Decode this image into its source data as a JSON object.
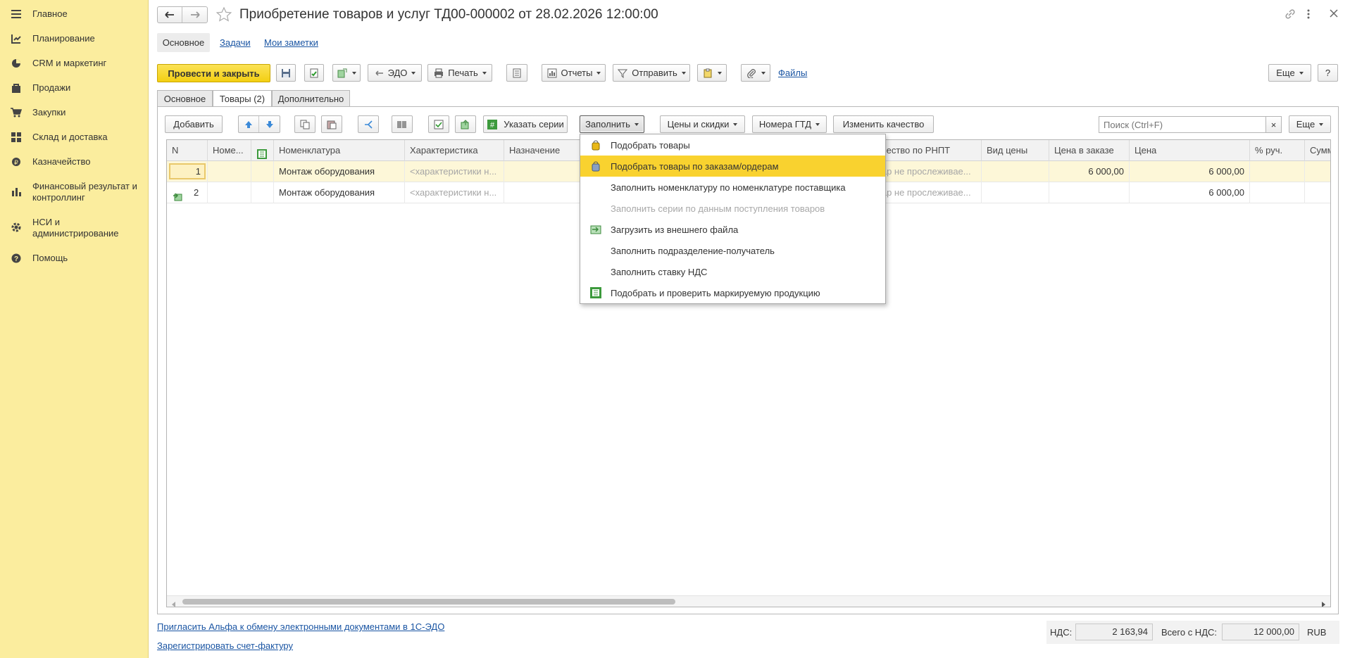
{
  "sidebar": {
    "items": [
      {
        "label": "Главное",
        "icon": "menu-icon"
      },
      {
        "label": "Планирование",
        "icon": "planning-icon"
      },
      {
        "label": "CRM и маркетинг",
        "icon": "crm-icon"
      },
      {
        "label": "Продажи",
        "icon": "sales-icon"
      },
      {
        "label": "Закупки",
        "icon": "cart-icon"
      },
      {
        "label": "Склад и доставка",
        "icon": "warehouse-icon"
      },
      {
        "label": "Казначейство",
        "icon": "treasury-icon"
      },
      {
        "label": "Финансовый результат и контроллинг",
        "icon": "finance-icon"
      },
      {
        "label": "НСИ и администрирование",
        "icon": "gear-icon"
      },
      {
        "label": "Помощь",
        "icon": "help-icon"
      }
    ]
  },
  "header": {
    "title": "Приобретение товаров и услуг ТД00-000002 от 28.02.2026 12:00:00"
  },
  "nav": {
    "main": "Основное",
    "tasks": "Задачи",
    "notes": "Мои заметки"
  },
  "toolbar": {
    "post_close": "Провести и закрыть",
    "edo": "ЭДО",
    "print": "Печать",
    "reports": "Отчеты",
    "send": "Отправить",
    "files": "Файлы",
    "more": "Еще",
    "help": "?"
  },
  "tabs": {
    "main": "Основное",
    "goods": "Товары (2)",
    "extra": "Дополнительно"
  },
  "goods_toolbar": {
    "add": "Добавить",
    "series": "Указать серии",
    "fill": "Заполнить",
    "prices": "Цены и скидки",
    "gtd": "Номера ГТД",
    "quality": "Изменить качество",
    "search_placeholder": "Поиск (Ctrl+F)",
    "clear": "×",
    "more": "Еще"
  },
  "table": {
    "headers": {
      "n": "N",
      "nome": "Номе...",
      "nomenclature": "Номенклатура",
      "characteristic": "Характеристика",
      "purpose": "Назначение",
      "rnpt": "...чество по РНПТ",
      "price_type": "Вид цены",
      "order_price": "Цена в заказе",
      "price": "Цена",
      "manual_pct": "% руч.",
      "sum": "Сумм"
    },
    "rows": [
      {
        "n": "1",
        "nomenclature": "Монтаж оборудования",
        "characteristic": "<характеристики н...",
        "rnpt": "...ар не прослеживае...",
        "order_price": "6 000,00",
        "price": "6 000,00"
      },
      {
        "n": "2",
        "nomenclature": "Монтаж оборудования",
        "characteristic": "<характеристики н...",
        "rnpt": "...ар не прослеживае...",
        "order_price": "",
        "price": "6 000,00"
      }
    ]
  },
  "fill_menu": {
    "items": [
      {
        "label": "Подобрать товары",
        "icon": "pick-goods-icon",
        "state": "normal"
      },
      {
        "label": "Подобрать товары по заказам/ордерам",
        "icon": "pick-orders-icon",
        "state": "highlighted"
      },
      {
        "label": "Заполнить номенклатуру по номенклатуре поставщика",
        "icon": "",
        "state": "normal"
      },
      {
        "label": "Заполнить серии по данным поступления товаров",
        "icon": "",
        "state": "disabled"
      },
      {
        "label": "Загрузить из внешнего файла",
        "icon": "load-file-icon",
        "state": "normal"
      },
      {
        "label": "Заполнить подразделение-получатель",
        "icon": "",
        "state": "normal"
      },
      {
        "label": "Заполнить ставку НДС",
        "icon": "",
        "state": "normal"
      },
      {
        "label": "Подобрать и проверить маркируемую продукцию",
        "icon": "marking-icon",
        "state": "normal"
      }
    ]
  },
  "footer": {
    "invite_link": "Пригласить Альфа к обмену электронными документами в 1С-ЭДО",
    "register_link": "Зарегистрировать счет-фактуру",
    "vat_label": "НДС:",
    "vat_value": "2 163,94",
    "total_label": "Всего с НДС:",
    "total_value": "12 000,00",
    "currency": "RUB"
  },
  "colors": {
    "sidebar_bg": "#fbed9e",
    "primary_button": "#f5d41c",
    "menu_highlight": "#f9d22f",
    "link": "#1a55a3",
    "row_selected": "#fdf7d8"
  }
}
